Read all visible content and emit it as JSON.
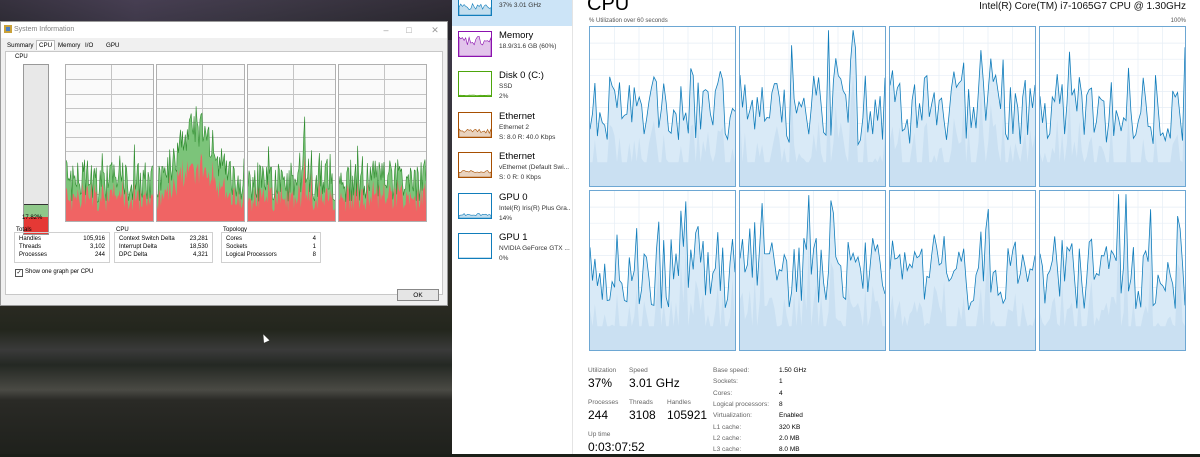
{
  "sysinfo": {
    "title": "System Information",
    "tabs": [
      "Summary",
      "CPU",
      "Memory",
      "I/O",
      "GPU"
    ],
    "active_tab": "CPU",
    "cpu_label": "CPU",
    "cpu_percent_text": "17.82%",
    "cpu_usage_fraction": 0.1782,
    "totals": {
      "header": "Totals",
      "rows": [
        [
          "Handles",
          "105,916"
        ],
        [
          "Threads",
          "3,102"
        ],
        [
          "Processes",
          "244"
        ]
      ]
    },
    "cpu": {
      "header": "CPU",
      "rows": [
        [
          "Context Switch Delta",
          "23,281"
        ],
        [
          "Interrupt Delta",
          "18,530"
        ],
        [
          "DPC Delta",
          "4,321"
        ]
      ]
    },
    "topology": {
      "header": "Topology",
      "rows": [
        [
          "Cores",
          "4"
        ],
        [
          "Sockets",
          "1"
        ],
        [
          "Logical Processors",
          "8"
        ]
      ]
    },
    "show_one_graph": "Show one graph per CPU",
    "ok_label": "OK",
    "colors": {
      "kernel": "#e53935",
      "user": "#43a047"
    }
  },
  "tm_list": [
    {
      "name": "CPU",
      "sub": "37%  3.01 GHz",
      "sub2": "",
      "color": "#117dbb",
      "selected": true
    },
    {
      "name": "Memory",
      "sub": "18.9/31.6 GB (60%)",
      "sub2": "",
      "color": "#8b12ae",
      "selected": false
    },
    {
      "name": "Disk 0 (C:)",
      "sub": "SSD",
      "sub2": "2%",
      "color": "#4da60c",
      "selected": false
    },
    {
      "name": "Ethernet",
      "sub": "Ethernet 2",
      "sub2": "S: 8.0  R: 40.0 Kbps",
      "color": "#a74f01",
      "selected": false
    },
    {
      "name": "Ethernet",
      "sub": "vEthernet (Default Swi...",
      "sub2": "S: 0  R: 0 Kbps",
      "color": "#a74f01",
      "selected": false
    },
    {
      "name": "GPU 0",
      "sub": "Intel(R) Iris(R) Plus Gra...",
      "sub2": "14%",
      "color": "#117dbb",
      "selected": false
    },
    {
      "name": "GPU 1",
      "sub": "NVIDIA GeForce GTX ...",
      "sub2": "0%",
      "color": "#117dbb",
      "selected": false
    }
  ],
  "tm_main": {
    "title": "CPU",
    "model": "Intel(R) Core(TM) i7-1065G7 CPU @ 1.30GHz",
    "graph_caption_left": "% Utilization over 60 seconds",
    "graph_caption_right": "100%",
    "stats": {
      "utilization_label": "Utilization",
      "utilization": "37%",
      "speed_label": "Speed",
      "speed": "3.01 GHz",
      "processes_label": "Processes",
      "processes": "244",
      "threads_label": "Threads",
      "threads": "3108",
      "handles_label": "Handles",
      "handles": "105921",
      "uptime_label": "Up time",
      "uptime": "0:03:07:52"
    },
    "specs": [
      [
        "Base speed:",
        "1.50 GHz"
      ],
      [
        "Sockets:",
        "1"
      ],
      [
        "Cores:",
        "4"
      ],
      [
        "Logical processors:",
        "8"
      ],
      [
        "Virtualization:",
        "Enabled"
      ],
      [
        "L1 cache:",
        "320 KB"
      ],
      [
        "L2 cache:",
        "2.0 MB"
      ],
      [
        "L3 cache:",
        "8.0 MB"
      ]
    ],
    "colors": {
      "line": "#117dbb",
      "fill": "#d9eaf7",
      "border": "#6da7d3"
    }
  }
}
